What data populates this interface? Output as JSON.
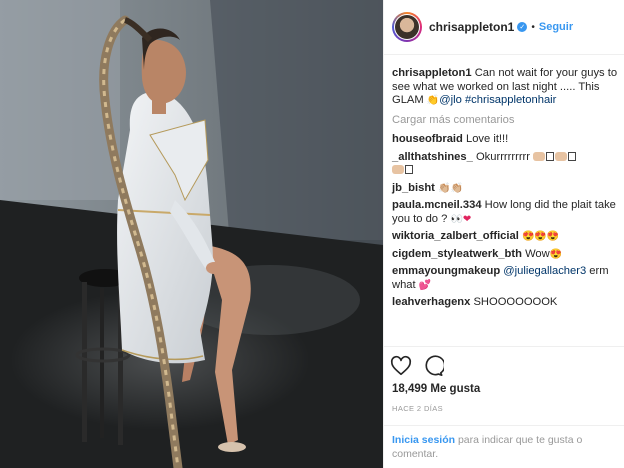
{
  "header": {
    "username": "chrisappleton1",
    "separator": "•",
    "follow_label": "Seguir"
  },
  "caption": {
    "user": "chrisappleton1",
    "text": "Can not wait for your guys to see what we worked on last night ..... This GLAM",
    "mention": "@jlo",
    "hashtag": "#chrisappletonhair"
  },
  "load_more": "Cargar más comentarios",
  "comments": [
    {
      "user": "houseofbraid",
      "text": "Love it!!!"
    },
    {
      "user": "_allthatshines_",
      "text": "Okurrrrrrrrr"
    },
    {
      "user": "jb_bisht",
      "text": ""
    },
    {
      "user": "paula.mcneil.334",
      "text": "How long did the plait take you to do ?"
    },
    {
      "user": "wiktoria_zalbert_official",
      "text": ""
    },
    {
      "user": "cigdem_styleatwerk_bth",
      "text": "Wow"
    },
    {
      "user": "emmayoungmakeup",
      "mention": "@juliegallacher3",
      "text": "erm what"
    },
    {
      "user": "leahverhagenx",
      "text": "SHOOOOOOOK"
    }
  ],
  "actions": {
    "likes": "18,499 Me gusta",
    "time_ago": "HACE 2 DÍAS"
  },
  "login": {
    "link": "Inicia sesión",
    "text": "para indicar que te gusta o comentar."
  },
  "colors": {
    "link_blue": "#3897f0",
    "mention_blue": "#003569",
    "muted": "#999999"
  },
  "icons": [
    "heart-icon",
    "comment-icon",
    "verified-badge-icon"
  ]
}
